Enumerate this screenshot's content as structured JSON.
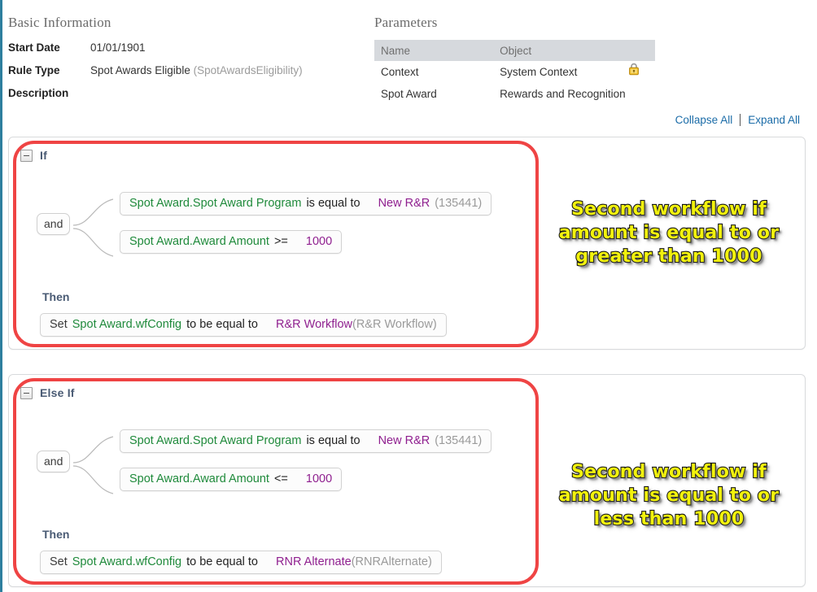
{
  "basic_information": {
    "title": "Basic Information",
    "rows": [
      {
        "label": "Start Date",
        "value": "01/01/1901",
        "muted": ""
      },
      {
        "label": "Rule Type",
        "value": "Spot Awards Eligible",
        "muted": "(SpotAwardsEligibility)"
      },
      {
        "label": "Description",
        "value": "",
        "muted": ""
      }
    ]
  },
  "parameters": {
    "title": "Parameters",
    "columns": [
      "Name",
      "Object"
    ],
    "rows": [
      {
        "name": "Context",
        "object": "System Context",
        "icon": "lock-icon",
        "locked": true
      },
      {
        "name": "Spot Award",
        "object": "Rewards and Recognition",
        "icon": "",
        "locked": false
      }
    ]
  },
  "toolbar": {
    "collapse_all": "Collapse All",
    "expand_all": "Expand All"
  },
  "rule_blocks": [
    {
      "head_label": "If",
      "toggle_icon": "minus-square-icon",
      "connector_label": "and",
      "conditions": [
        {
          "field": "Spot Award.Spot Award Program",
          "operator": "is equal to",
          "value": "New R&R",
          "value_id": "(135441)"
        },
        {
          "field": "Spot Award.Award Amount",
          "operator": ">=",
          "value": "1000",
          "value_id": ""
        }
      ],
      "then_label": "Then",
      "action": {
        "keyword": "Set",
        "field": "Spot Award.wfConfig",
        "operator": "to be equal to",
        "value": "R&R Workflow",
        "value_id": "(R&R Workflow)"
      },
      "annotation": "Second workflow if amount is equal to or greater than 1000"
    },
    {
      "head_label": "Else If",
      "toggle_icon": "minus-square-icon",
      "connector_label": "and",
      "conditions": [
        {
          "field": "Spot Award.Spot Award Program",
          "operator": "is equal to",
          "value": "New R&R",
          "value_id": "(135441)"
        },
        {
          "field": "Spot Award.Award Amount",
          "operator": "<=",
          "value": "1000",
          "value_id": ""
        }
      ],
      "then_label": "Then",
      "action": {
        "keyword": "Set",
        "field": "Spot Award.wfConfig",
        "operator": "to be equal to",
        "value": "RNR Alternate",
        "value_id": "(RNRAlternate)"
      },
      "annotation": "Second workflow if amount is equal to or less than 1000"
    }
  ],
  "colors": {
    "field_green": "#1f8a3b",
    "value_purple": "#8f1f8f",
    "id_gray": "#9a9a9a",
    "link_blue": "#1b6ca8",
    "highlight_red": "#ef4444",
    "annotation_yellow": "#f2f20d",
    "header_gray": "#6b6b6b",
    "table_header_bg": "#d6d9dd",
    "left_rule_teal": "#2e7f9e"
  }
}
